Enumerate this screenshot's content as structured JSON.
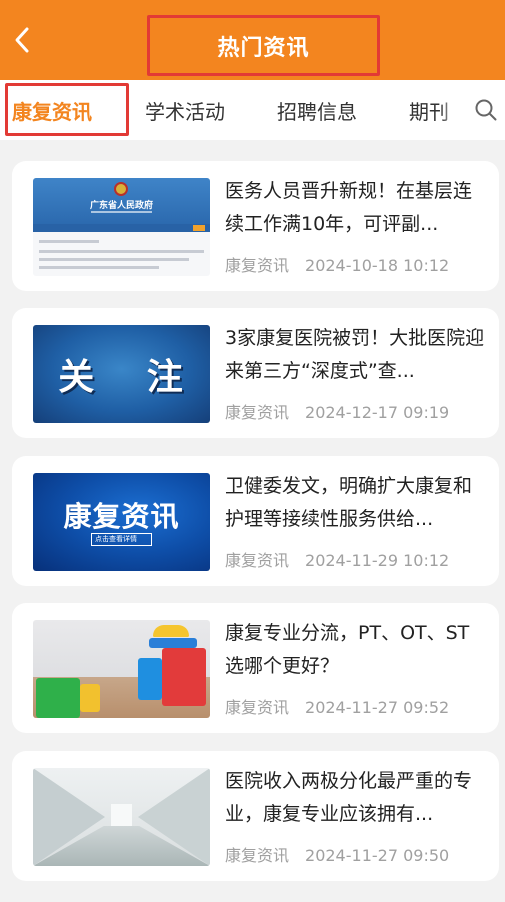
{
  "header": {
    "title": "热门资讯",
    "back_icon": "chevron-left-icon",
    "background_color": "#f3851f"
  },
  "tabs": [
    {
      "label": "康复资讯",
      "active": true
    },
    {
      "label": "学术活动",
      "active": false
    },
    {
      "label": "招聘信息",
      "active": false
    },
    {
      "label": "期刊",
      "active": false
    }
  ],
  "search_icon": "search-icon",
  "accent_color": "#f3851f",
  "highlight_color": "#e23a35",
  "articles": [
    {
      "title": "医务人员晋升新规！在基层连续工作满10年，可评副...",
      "category": "康复资讯",
      "date": "2024-10-18 10:12",
      "thumb_text": "广东省人民政府"
    },
    {
      "title": "3家康复医院被罚！大批医院迎来第三方“深度式”查...",
      "category": "康复资讯",
      "date": "2024-12-17 09:19",
      "thumb_text": "关 注"
    },
    {
      "title": "卫健委发文，明确扩大康复和护理等接续性服务供给...",
      "category": "康复资讯",
      "date": "2024-11-29 10:12",
      "thumb_text": "康复资讯",
      "thumb_subtext": "点击查看详情"
    },
    {
      "title": "康复专业分流，PT、OT、ST选哪个更好？",
      "category": "康复资讯",
      "date": "2024-11-27 09:52"
    },
    {
      "title": "医院收入两极分化最严重的专业，康复专业应该拥有...",
      "category": "康复资讯",
      "date": "2024-11-27 09:50"
    }
  ]
}
